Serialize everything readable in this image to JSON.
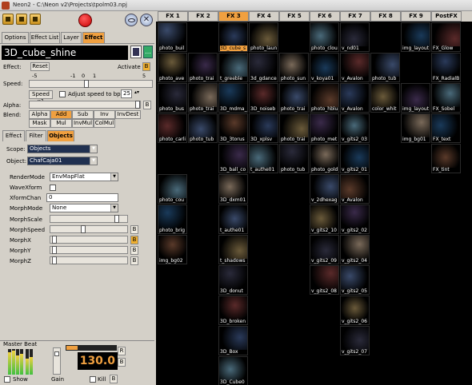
{
  "window": {
    "title": "Neon2 - C:\\Neon v2\\Projects\\tpolm03.npj"
  },
  "tabs": [
    "Options",
    "Effect List",
    "Layer",
    "Effect"
  ],
  "effect": {
    "name": "3D_cube_shine",
    "effect_label": "Effect:",
    "reset": "Reset",
    "activate": "Activate",
    "b": "B",
    "speed_label": "Speed:",
    "speed_scale": [
      "-5",
      "-1",
      "0",
      "1",
      "5"
    ],
    "speed_x1": "Speed x1",
    "adjust_label": "Adjust speed to bpm",
    "adjust_value": "25",
    "alpha_label": "Alpha:",
    "blend_label": "Blend:",
    "blend_row1": [
      "Alpha",
      "Add",
      "Sub",
      "Inv",
      "InvDest"
    ],
    "blend_row2": [
      "Mask",
      "Mul",
      "InvMul",
      "ColMul"
    ]
  },
  "subtabs": [
    "Effect",
    "Filter",
    "Objects"
  ],
  "objects": {
    "scope_label": "Scope:",
    "scope_value": "Objects",
    "object_label": "Object:",
    "object_value": "ChafCaja01",
    "params": [
      {
        "label": "RenderMode",
        "value": "EnvMapFlat"
      },
      {
        "label": "WaveXform",
        "value": ""
      },
      {
        "label": "XformChan",
        "value": "0"
      },
      {
        "label": "MorphMode",
        "value": "None"
      }
    ],
    "sliders": [
      "MorphScale",
      "MorphSpeed",
      "MorphX",
      "MorphY",
      "MorphZ"
    ]
  },
  "beat": {
    "title": "Master Beat",
    "bpm": "130.0",
    "r": "R",
    "show": "Show",
    "gain": "Gain",
    "kill": "Kill",
    "b": "B"
  },
  "grid": {
    "headers": [
      "FX 1",
      "FX 2",
      "FX 3",
      "FX 4",
      "FX 5",
      "FX 6",
      "FX 7",
      "FX 8",
      "FX 9",
      "PostFX"
    ],
    "rows": [
      [
        "photo_buil",
        "",
        "3D_cube_s",
        "photo_laun",
        "",
        "photo_clou",
        "v_nd01",
        "",
        "img_layout",
        "FX_Glow"
      ],
      [
        "photo_ave",
        "photo_trai",
        "t_greeble",
        "3d_gdance",
        "photo_sun",
        "v_koya01",
        "v_Avalon",
        "photo_tub",
        "",
        "FX_RadialB"
      ],
      [
        "photo_bus",
        "photo_trai",
        "3D_mdma_",
        "3D_noiseb",
        "photo_trai",
        "photo_hblu",
        "v_Avalon",
        "color_whit",
        "img_layout",
        "FX_Sobel"
      ],
      [
        "photo_carli",
        "photo_tub",
        "3D_3torus",
        "3D_xplsv",
        "photo_trai",
        "photo_met",
        "v_gits2_03",
        "",
        "img_bg01",
        "FX_text"
      ],
      [
        "",
        "",
        "3D_ball_co",
        "t_authe01",
        "photo_tub",
        "photo_gold",
        "v_gits2_01",
        "",
        "",
        "FX_tint"
      ],
      [
        "photo_cou",
        "",
        "3D_dxm01",
        "",
        "",
        "v_2dhexag",
        "v_Avalon",
        "",
        "",
        ""
      ],
      [
        "photo_brig",
        "",
        "t_authe01",
        "",
        "",
        "v_gits2_10",
        "v_gits2_02",
        "",
        "",
        ""
      ],
      [
        "img_bg02",
        "",
        "t_shadows",
        "",
        "",
        "v_gits2_09",
        "v_gits2_04",
        "",
        "",
        ""
      ],
      [
        "",
        "",
        "3D_donut",
        "",
        "",
        "v_gits2_08",
        "v_gits2_05",
        "",
        "",
        ""
      ],
      [
        "",
        "",
        "3D_broken",
        "",
        "",
        "",
        "v_gits2_06",
        "",
        "",
        ""
      ],
      [
        "",
        "",
        "3D_Box",
        "",
        "",
        "",
        "v_gits2_07",
        "",
        "",
        ""
      ],
      [
        "",
        "",
        "3D_Cube0",
        "",
        "",
        "",
        "",
        "",
        "",
        ""
      ]
    ],
    "active_col": 2,
    "selected": "3D_cube_s"
  },
  "colors": {
    "accent": "#f0a040",
    "panel": "#d4d0c8",
    "grid_bg": "#000000"
  }
}
